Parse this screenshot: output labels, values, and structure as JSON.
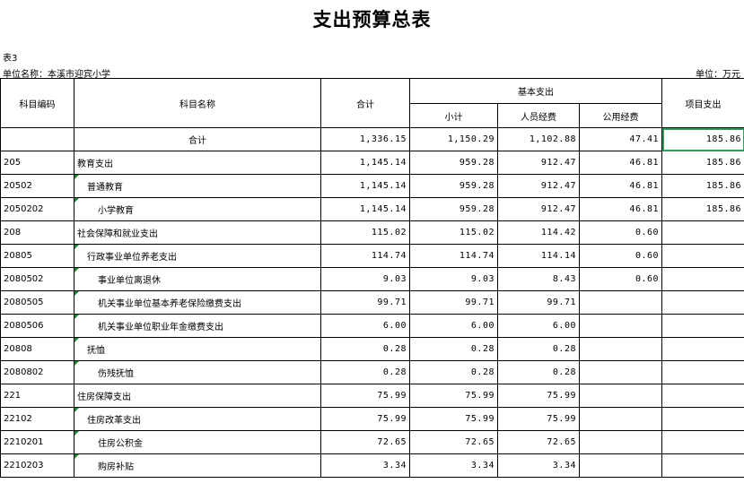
{
  "title": "支出预算总表",
  "table_no": "表3",
  "unit_name": "单位名称：本溪市迎宾小学",
  "unit": "单位：万元",
  "headers": {
    "code": "科目编码",
    "name": "科目名称",
    "total": "合计",
    "basic": "基本支出",
    "subtotal": "小计",
    "personnel": "人员经费",
    "public": "公用经费",
    "project": "项目支出"
  },
  "rows": [
    {
      "code": "",
      "name": "合计",
      "total": "1,336.15",
      "subtotal": "1,150.29",
      "personnel": "1,102.88",
      "public": "47.41",
      "project": "185.86"
    },
    {
      "code": "205",
      "name": "教育支出",
      "total": "1,145.14",
      "subtotal": "959.28",
      "personnel": "912.47",
      "public": "46.81",
      "project": "185.86"
    },
    {
      "code": "20502",
      "name": "普通教育",
      "total": "1,145.14",
      "subtotal": "959.28",
      "personnel": "912.47",
      "public": "46.81",
      "project": "185.86"
    },
    {
      "code": "2050202",
      "name": "小学教育",
      "total": "1,145.14",
      "subtotal": "959.28",
      "personnel": "912.47",
      "public": "46.81",
      "project": "185.86"
    },
    {
      "code": "208",
      "name": "社会保障和就业支出",
      "total": "115.02",
      "subtotal": "115.02",
      "personnel": "114.42",
      "public": "0.60",
      "project": ""
    },
    {
      "code": "20805",
      "name": "行政事业单位养老支出",
      "total": "114.74",
      "subtotal": "114.74",
      "personnel": "114.14",
      "public": "0.60",
      "project": ""
    },
    {
      "code": "2080502",
      "name": "事业单位离退休",
      "total": "9.03",
      "subtotal": "9.03",
      "personnel": "8.43",
      "public": "0.60",
      "project": ""
    },
    {
      "code": "2080505",
      "name": "机关事业单位基本养老保险缴费支出",
      "total": "99.71",
      "subtotal": "99.71",
      "personnel": "99.71",
      "public": "",
      "project": ""
    },
    {
      "code": "2080506",
      "name": "机关事业单位职业年金缴费支出",
      "total": "6.00",
      "subtotal": "6.00",
      "personnel": "6.00",
      "public": "",
      "project": ""
    },
    {
      "code": "20808",
      "name": "抚恤",
      "total": "0.28",
      "subtotal": "0.28",
      "personnel": "0.28",
      "public": "",
      "project": ""
    },
    {
      "code": "2080802",
      "name": "伤残抚恤",
      "total": "0.28",
      "subtotal": "0.28",
      "personnel": "0.28",
      "public": "",
      "project": ""
    },
    {
      "code": "221",
      "name": "住房保障支出",
      "total": "75.99",
      "subtotal": "75.99",
      "personnel": "75.99",
      "public": "",
      "project": ""
    },
    {
      "code": "22102",
      "name": "住房改革支出",
      "total": "75.99",
      "subtotal": "75.99",
      "personnel": "75.99",
      "public": "",
      "project": ""
    },
    {
      "code": "2210201",
      "name": "住房公积金",
      "total": "72.65",
      "subtotal": "72.65",
      "personnel": "72.65",
      "public": "",
      "project": ""
    },
    {
      "code": "2210203",
      "name": "购房补贴",
      "total": "3.34",
      "subtotal": "3.34",
      "personnel": "3.34",
      "public": "",
      "project": ""
    }
  ]
}
